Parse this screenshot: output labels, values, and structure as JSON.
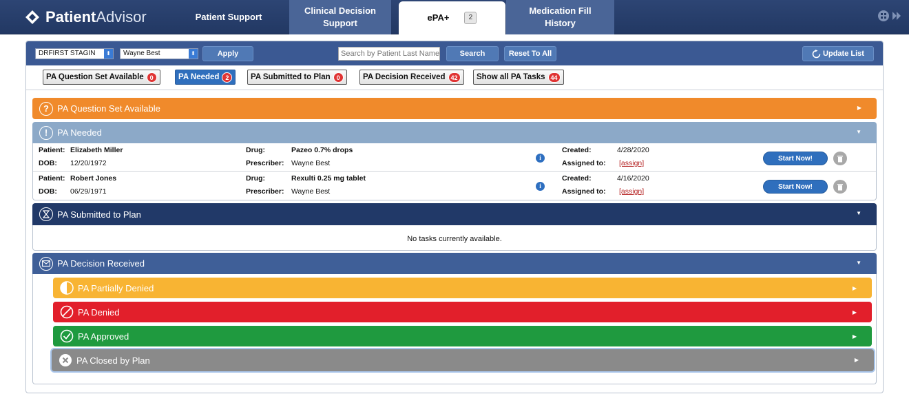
{
  "app": {
    "brand_strong": "Patient",
    "brand_light": "Advisor"
  },
  "nav": {
    "patient_support": "Patient Support",
    "clinical_decision_l1": "Clinical Decision",
    "clinical_decision_l2": "Support",
    "epa": "ePA+",
    "epa_count": "2",
    "medication_l1": "Medication Fill",
    "medication_l2": "History"
  },
  "toolbar": {
    "org_select": "DRFIRST STAGIN",
    "user_select": "Wayne Best",
    "apply": "Apply",
    "search_placeholder": "Search by Patient Last Name",
    "search": "Search",
    "reset": "Reset To All",
    "update": "Update List"
  },
  "filters": [
    {
      "label": "PA Question Set Available",
      "count": "0"
    },
    {
      "label": "PA Needed",
      "count": "2"
    },
    {
      "label": "PA Submitted to Plan",
      "count": "0"
    },
    {
      "label": "PA Decision Received",
      "count": "42"
    },
    {
      "label": "Show all PA Tasks",
      "count": "44"
    }
  ],
  "sections": {
    "question_set": "PA Question Set Available",
    "needed": "PA Needed",
    "submitted": "PA Submitted to Plan",
    "decision": "PA Decision Received",
    "no_tasks": "No tasks currently available."
  },
  "labels": {
    "patient": "Patient:",
    "dob": "DOB:",
    "drug": "Drug:",
    "prescriber": "Prescriber:",
    "created": "Created:",
    "assigned": "Assigned to:",
    "assign_link": "[assign]",
    "start": "Start Now!"
  },
  "tasks": [
    {
      "patient": "Elizabeth Miller",
      "dob": "12/20/1972",
      "drug": "Pazeo 0.7% drops",
      "prescriber": "Wayne Best",
      "created": "4/28/2020"
    },
    {
      "patient": "Robert Jones",
      "dob": "06/29/1971",
      "drug": "Rexulti 0.25 mg tablet",
      "prescriber": "Wayne Best",
      "created": "4/16/2020"
    }
  ],
  "decision_sub": {
    "partially_denied": "PA Partially Denied",
    "denied": "PA Denied",
    "approved": "PA Approved",
    "closed": "PA Closed by Plan"
  },
  "colors": {
    "nav_bg": "#223863",
    "orange": "#f08a2b",
    "needed": "#8ca9c8",
    "submitted": "#213968",
    "decision": "#3f5f98",
    "partial": "#f8b433",
    "denied": "#e21f2b",
    "approved": "#1f9a3f",
    "closed": "#8a8a8a"
  }
}
